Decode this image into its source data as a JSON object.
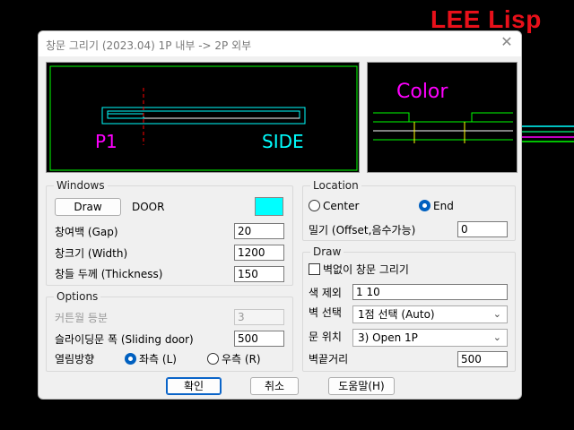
{
  "brand": "LEE Lisp",
  "window": {
    "title": "창문 그리기 (2023.04)    1P 내부 -> 2P 외부"
  },
  "preview": {
    "left_text_1": "P1",
    "left_text_2": "SIDE",
    "right_text": "Color"
  },
  "windows_group": {
    "title": "Windows",
    "draw_button": "Draw",
    "type_label": "DOOR",
    "color_swatch": "#00ffff",
    "fields": [
      {
        "label": "창여백 (Gap)",
        "value": "20"
      },
      {
        "label": "창크기 (Width)",
        "value": "1200"
      },
      {
        "label": "창들 두께 (Thickness)",
        "value": "150"
      }
    ]
  },
  "options_group": {
    "title": "Options",
    "curtain_label": "커튼월 등분",
    "curtain_value": "3",
    "sliding_label": "슬라이딩문 폭 (Sliding door)",
    "sliding_value": "500",
    "open_dir_label": "열림방향",
    "open_left": "좌측 (L)",
    "open_right": "우측 (R)",
    "selected": "left"
  },
  "location_group": {
    "title": "Location",
    "opt_center": "Center",
    "opt_end": "End",
    "selected": "End",
    "offset_label": "밀기 (Offset,음수가능)",
    "offset_value": "0"
  },
  "draw_group": {
    "title": "Draw",
    "no_wall_label": "벽없이 창문 그리기",
    "no_wall_checked": false,
    "exclude_color_label": "색 제외",
    "exclude_color_value": "1 10",
    "wall_select_label": "벽 선택",
    "wall_select_value": "1점 선택 (Auto)",
    "door_pos_label": "문 위치",
    "door_pos_value": "3) Open 1P",
    "wall_end_label": "벽끝거리",
    "wall_end_value": "500"
  },
  "footer": {
    "ok": "확인",
    "cancel": "취소",
    "help": "도움말(H)"
  },
  "colors": {
    "preview_border": "#00ff00",
    "window_cyan": "#00ffff",
    "magenta": "#ff00ff",
    "red_axis": "#ff0000",
    "yellow": "#ffff00",
    "brand_red": "#e8101a"
  }
}
